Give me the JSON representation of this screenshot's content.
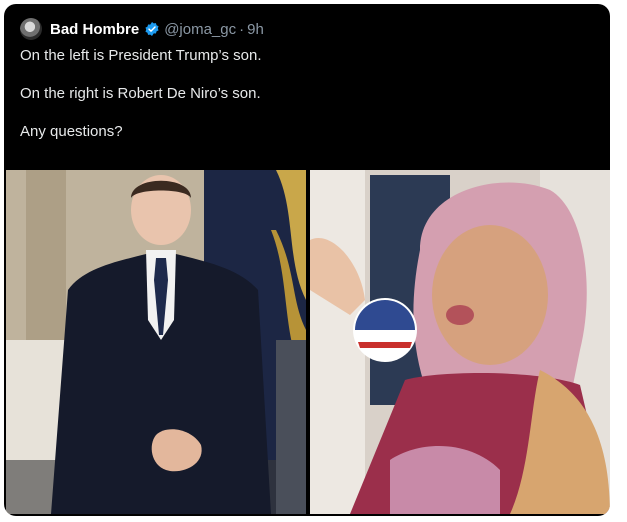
{
  "tweet": {
    "display_name": "Bad Hombre",
    "handle": "@joma_gc",
    "separator": "·",
    "time": "9h",
    "lines": [
      "On the left is President Trump’s son.",
      "On the right is Robert De Niro’s son.",
      "Any questions?"
    ]
  },
  "media": {
    "left_photo": "young man in dark suit standing",
    "right_photo": "person in pink headscarf holding voting sticker"
  },
  "colors": {
    "background": "#000000",
    "text": "#e7e9ea",
    "muted": "#8b98a5",
    "verified": "#1d9bf0"
  },
  "icons": {
    "verified": "verified-badge-icon"
  }
}
